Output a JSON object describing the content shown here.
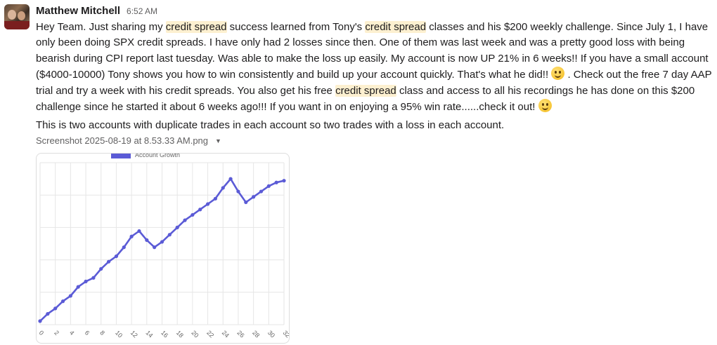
{
  "message": {
    "author": "Matthew Mitchell",
    "time": "6:52 AM",
    "segments": [
      {
        "text": "Hey Team.  Just sharing my ",
        "hl": false
      },
      {
        "text": "credit spread",
        "hl": true
      },
      {
        "text": " success learned from Tony's ",
        "hl": false
      },
      {
        "text": "credit spread",
        "hl": true
      },
      {
        "text": " classes and his $200 weekly challenge.  Since July 1, I have only been doing SPX credit spreads.  I have only had 2 losses since then.  One of them was last week and was a pretty good loss with being bearish during CPI report last tuesday.  Was able to make the loss up easily.  My account is now UP 21% in 6 weeks!!  If you have a small account ($4000-10000) Tony shows you how to win consistently and build up your account quickly.  That's what he did!! ",
        "hl": false
      },
      {
        "emoji": "slightly-smiling-face"
      },
      {
        "text": " .   Check out the free 7 day AAP trial and try a week with his credit spreads.  You also get his free ",
        "hl": false
      },
      {
        "text": "credit spread",
        "hl": true
      },
      {
        "text": " class and access to all his recordings he has done on this $200 challenge since he started it about 6 weeks ago!!!  If you want in on enjoying a 95% win rate......check it out! ",
        "hl": false
      },
      {
        "emoji": "slightly-smiling-face"
      }
    ],
    "second_paragraph": "This is two accounts with duplicate trades in each account so two trades with a loss in each account.",
    "attachment": {
      "filename": "Screenshot 2025-08-19 at 8.53.33 AM.png",
      "menu_icon": "caret-down-icon"
    }
  },
  "colors": {
    "highlight": "#fdf0d0",
    "line": "#5b5bd6",
    "grid": "#e6e6e6"
  },
  "chart_data": {
    "type": "line",
    "legend": [
      "Account Growth"
    ],
    "x": [
      0,
      1,
      2,
      3,
      4,
      5,
      6,
      7,
      8,
      9,
      10,
      11,
      12,
      13,
      14,
      15,
      16,
      17,
      18,
      19,
      20,
      21,
      22,
      23,
      24,
      25,
      26,
      27,
      28,
      29,
      30,
      31,
      32
    ],
    "x_tick_labels": [
      "0",
      "2",
      "4",
      "6",
      "8",
      "10",
      "12",
      "14",
      "16",
      "18",
      "20",
      "22",
      "24",
      "26",
      "28",
      "30",
      "32"
    ],
    "series": [
      {
        "name": "Account Growth",
        "values": [
          0.2,
          0.6,
          0.9,
          1.3,
          1.6,
          2.1,
          2.4,
          2.6,
          3.1,
          3.5,
          3.8,
          4.3,
          4.9,
          5.2,
          4.7,
          4.3,
          4.6,
          5.0,
          5.4,
          5.8,
          6.1,
          6.4,
          6.7,
          7.0,
          7.6,
          8.1,
          7.4,
          6.8,
          7.1,
          7.4,
          7.7,
          7.9,
          8.0
        ]
      }
    ],
    "xlim": [
      0,
      32
    ],
    "ylim": [
      0,
      9
    ],
    "grid": true,
    "legend_position": "top"
  }
}
